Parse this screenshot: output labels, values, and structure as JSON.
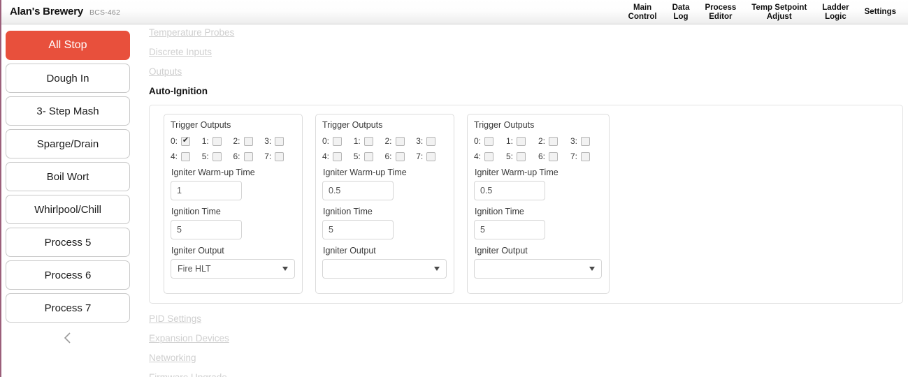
{
  "header": {
    "brand_title": "Alan's Brewery",
    "brand_model": "BCS-462",
    "nav": [
      {
        "label": "Main\nControl"
      },
      {
        "label": "Data\nLog"
      },
      {
        "label": "Process\nEditor"
      },
      {
        "label": "Temp Setpoint\nAdjust"
      },
      {
        "label": "Ladder\nLogic"
      },
      {
        "label": "Settings"
      }
    ]
  },
  "sidebar": {
    "buttons": [
      {
        "label": "All Stop",
        "style": "stop"
      },
      {
        "label": "Dough In",
        "style": "normal"
      },
      {
        "label": "3- Step Mash",
        "style": "normal"
      },
      {
        "label": "Sparge/Drain",
        "style": "normal"
      },
      {
        "label": "Boil Wort",
        "style": "normal"
      },
      {
        "label": "Whirlpool/Chill",
        "style": "normal"
      },
      {
        "label": "Process 5",
        "style": "normal"
      },
      {
        "label": "Process 6",
        "style": "normal"
      },
      {
        "label": "Process 7",
        "style": "normal"
      }
    ],
    "collapse_icon": "chevron-left-icon"
  },
  "main": {
    "top_links": [
      {
        "label": "Temperature Probes"
      },
      {
        "label": "Discrete Inputs"
      },
      {
        "label": "Outputs"
      }
    ],
    "section_title": "Auto-Ignition",
    "bottom_links": [
      {
        "label": "PID Settings"
      },
      {
        "label": "Expansion Devices"
      },
      {
        "label": "Networking"
      },
      {
        "label": "Firmware Upgrade"
      }
    ],
    "cards": [
      {
        "trigger_label": "Trigger Outputs",
        "checkbox_labels": [
          "0:",
          "1:",
          "2:",
          "3:",
          "4:",
          "5:",
          "6:",
          "7:"
        ],
        "checkbox_states": [
          true,
          false,
          false,
          false,
          false,
          false,
          false,
          false
        ],
        "warmup_label": "Igniter Warm-up Time",
        "warmup_value": "1",
        "ignition_label": "Ignition Time",
        "ignition_value": "5",
        "output_label": "Igniter Output",
        "output_value": "Fire HLT"
      },
      {
        "trigger_label": "Trigger Outputs",
        "checkbox_labels": [
          "0:",
          "1:",
          "2:",
          "3:",
          "4:",
          "5:",
          "6:",
          "7:"
        ],
        "checkbox_states": [
          false,
          false,
          false,
          false,
          false,
          false,
          false,
          false
        ],
        "warmup_label": "Igniter Warm-up Time",
        "warmup_value": "0.5",
        "ignition_label": "Ignition Time",
        "ignition_value": "5",
        "output_label": "Igniter Output",
        "output_value": ""
      },
      {
        "trigger_label": "Trigger Outputs",
        "checkbox_labels": [
          "0:",
          "1:",
          "2:",
          "3:",
          "4:",
          "5:",
          "6:",
          "7:"
        ],
        "checkbox_states": [
          false,
          false,
          false,
          false,
          false,
          false,
          false,
          false
        ],
        "warmup_label": "Igniter Warm-up Time",
        "warmup_value": "0.5",
        "ignition_label": "Ignition Time",
        "ignition_value": "5",
        "output_label": "Igniter Output",
        "output_value": ""
      }
    ]
  },
  "colors": {
    "stop_red": "#e8503c",
    "accent_edge": "#9b5f7a",
    "link_grey": "#cfcfcf"
  }
}
